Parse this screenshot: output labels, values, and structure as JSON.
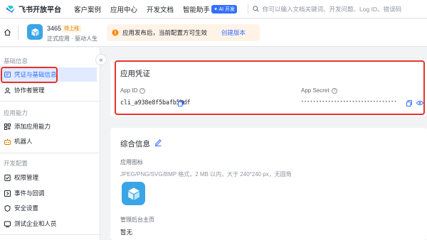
{
  "topbar": {
    "logo_text": "飞书开放平台",
    "nav": [
      "客户案例",
      "应用中心",
      "开发文档",
      "智能助手"
    ],
    "ai_badge": "✦ AI 开发",
    "search_placeholder": "你可以输入文档关键词、开发问题、Log ID、错误码"
  },
  "appbar": {
    "app_name": "3465",
    "app_status": "待上线",
    "app_desc": "正式应用 · 驱动人生",
    "notice_text": "应用发布后，当前配置方可生效",
    "notice_link": "创建版本"
  },
  "sidebar": {
    "groups": [
      "基础信息",
      "应用能力",
      "开发配置"
    ],
    "items": [
      {
        "label": "凭证与基础信息",
        "icon": "credential-icon",
        "active": true
      },
      {
        "label": "协作者管理",
        "icon": "collaborator-icon"
      },
      {
        "label": "添加应用能力",
        "icon": "add-capability-icon"
      },
      {
        "label": "机器人",
        "icon": "robot-icon"
      },
      {
        "label": "权限管理",
        "icon": "permission-icon"
      },
      {
        "label": "事件与回调",
        "icon": "event-icon"
      },
      {
        "label": "安全设置",
        "icon": "security-icon"
      },
      {
        "label": "测试企业和人员",
        "icon": "test-users-icon"
      }
    ]
  },
  "credentials": {
    "title": "应用凭证",
    "app_id_label": "App ID",
    "app_id_value": "cli_a938e8f5bafb5bdf",
    "app_secret_label": "App Secret",
    "app_secret_value": "••••••••••••••••••••••••••••••••"
  },
  "info": {
    "title": "综合信息",
    "icon_label": "应用图标",
    "icon_hint": "JPEG/PNG/SVG/BMP 格式，2 MB 以内，大于 240*240 px，无圆角",
    "home_label": "管理后台主页",
    "home_value": "暂无"
  },
  "colors": {
    "accent": "#3370ff",
    "highlight": "#e5322d",
    "app_icon": "#3aa5e6"
  }
}
